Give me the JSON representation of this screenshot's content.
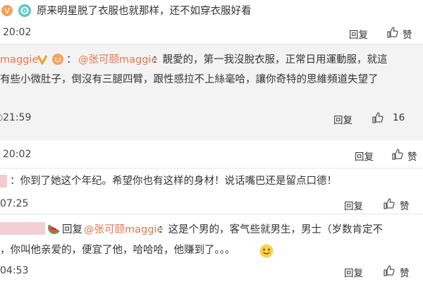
{
  "comments": [
    {
      "text": "原来明星脱了衣服也就那样，还不如穿衣服好看",
      "time": "20:02",
      "reply_label": "回复",
      "like_label": "赞"
    },
    {
      "username": "maggie",
      "mention": "@张可颐maggie",
      "line1": "：靚愛的，第一我沒脫衣服，正常日用運動服，就這",
      "line2": "有些小微肚子，倒沒有三腿四臂，跟性感拉不上絲毫哈，讓你奇特的思維頻道失望了",
      "time": "21:59",
      "reply_label": "回复",
      "like_count": "16"
    },
    {
      "time": "20:02",
      "reply_label": "回复",
      "like_label": "赞"
    },
    {
      "text": "：你到了她这个年纪。希望你也有这样的身材！说话嘴巴还是留点口德！",
      "time": "07:25",
      "reply_label": "回复",
      "like_label": "赞"
    },
    {
      "prefix": "回复",
      "mention": "@张可颐maggie",
      "line1": "：这是个男的，客气些就男生，男士（岁数肯定不",
      "line2": "，你叫他亲爱的，便宜了他，哈哈哈，他赚到了。。。",
      "time": "04:53",
      "reply_label": "回复",
      "like_label": "赞"
    }
  ]
}
